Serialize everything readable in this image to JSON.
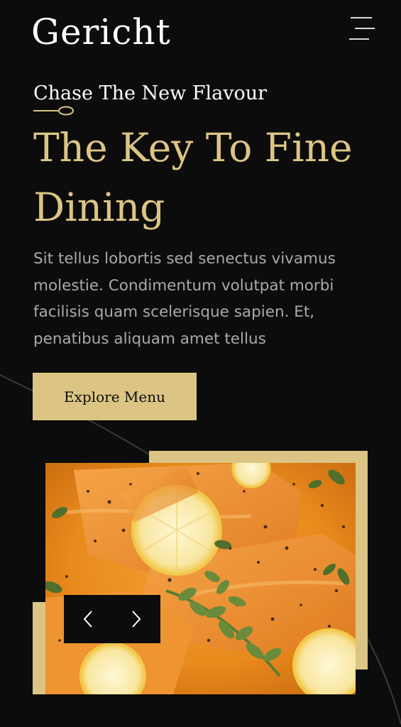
{
  "brand": {
    "logo_text": "Gericht"
  },
  "nav": {
    "menu_icon": "hamburger-menu-icon"
  },
  "hero": {
    "kicker": "Chase The New Flavour",
    "kicker_icon": "spoon-icon",
    "headline": "The Key To Fine Dining",
    "description": "Sit tellus lobortis sed senectus vivamus molestie. Condimentum volutpat morbi facilisis quam scelerisque sapien. Et, penatibus aliquam amet tellus",
    "cta_label": "Explore Menu"
  },
  "gallery": {
    "photo": "salmon-dish-photo",
    "prev_icon": "chevron-left-icon",
    "next_icon": "chevron-right-icon"
  },
  "colors": {
    "background": "#0c0c0c",
    "accent_gold": "#dcc584",
    "text_white": "#ffffff",
    "text_muted": "#aaaaaa"
  }
}
